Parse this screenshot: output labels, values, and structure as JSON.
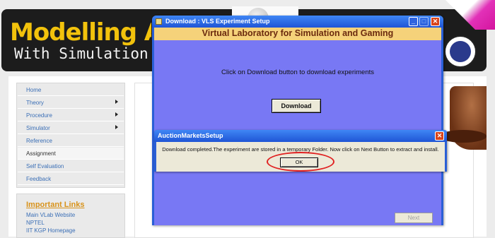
{
  "site": {
    "title_line1": "Modelling A",
    "title_line2": "With Simulation",
    "nav": [
      {
        "label": "Home",
        "has_arrow": false
      },
      {
        "label": "Theory",
        "has_arrow": true
      },
      {
        "label": "Procedure",
        "has_arrow": true
      },
      {
        "label": "Simulator",
        "has_arrow": true
      },
      {
        "label": "Reference",
        "has_arrow": false
      },
      {
        "label": "Assignment",
        "has_arrow": false,
        "active": true
      },
      {
        "label": "Self Evaluation",
        "has_arrow": false
      },
      {
        "label": "Feedback",
        "has_arrow": false
      }
    ],
    "important_links": {
      "title": "Important Links",
      "items": [
        "Main VLab Website",
        "NPTEL",
        "IIT KGP Homepage"
      ]
    }
  },
  "setup_window": {
    "title": "Download  : VLS Experiment Setup",
    "heading": "Virtual Laboratory for Simulation and Gaming",
    "instruction": "Click on Download button to download experiments",
    "download_label": "Download",
    "next_label": "Next",
    "controls": {
      "minimize": "_",
      "maximize": "□",
      "close": "✕"
    }
  },
  "message_box": {
    "title": "AuctionMarketsSetup",
    "text": "Download completed.The experiment are stored in a temporary Folder. Now click on Next Button to extract and install.",
    "ok_label": "OK",
    "close": "✕"
  },
  "colors": {
    "header_yellow": "#f2c20c",
    "window_body": "#7878f4",
    "heading_band": "#f5d27a",
    "titlebar_blue": "#1f55d5",
    "highlight_red": "#e02222",
    "link_blue": "#3b6fb6",
    "links_title": "#d8921a"
  }
}
